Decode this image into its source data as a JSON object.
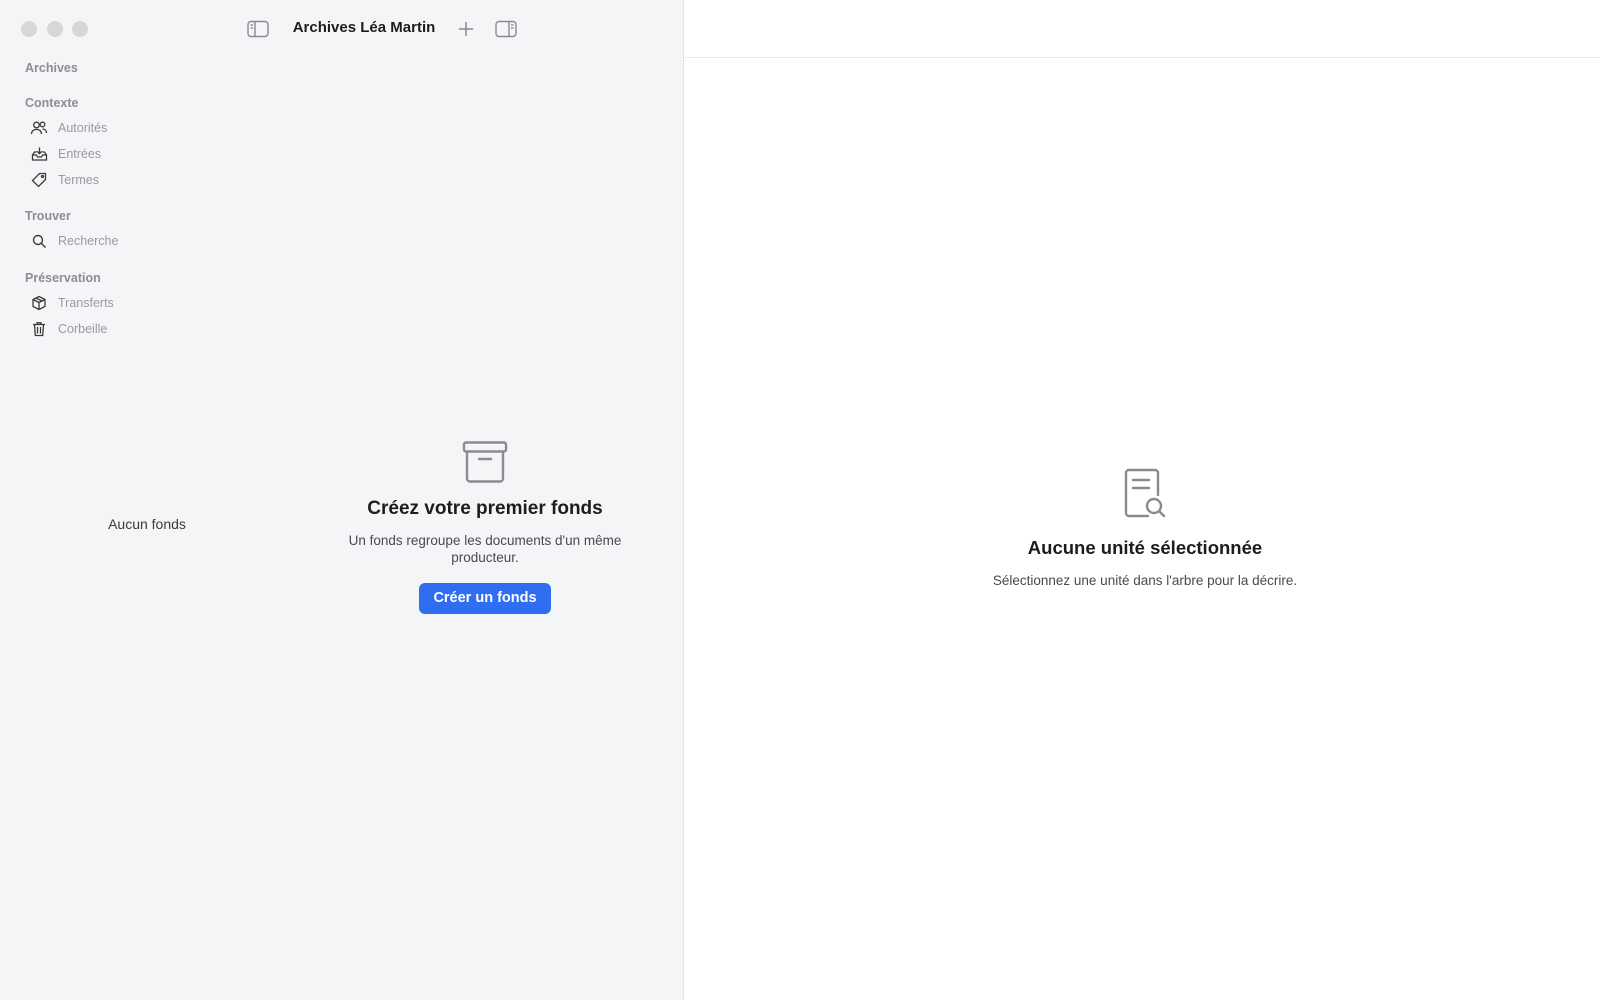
{
  "window": {
    "title": "Archives Léa Martin"
  },
  "sidebar": {
    "root_label": "Archives",
    "sections": [
      {
        "title": "Contexte",
        "items": [
          {
            "label": "Autorités",
            "icon": "users-icon"
          },
          {
            "label": "Entrées",
            "icon": "inbox-tray-icon"
          },
          {
            "label": "Termes",
            "icon": "tag-icon"
          }
        ]
      },
      {
        "title": "Trouver",
        "items": [
          {
            "label": "Recherche",
            "icon": "search-icon"
          }
        ]
      },
      {
        "title": "Préservation",
        "items": [
          {
            "label": "Transferts",
            "icon": "package-icon"
          },
          {
            "label": "Corbeille",
            "icon": "trash-icon"
          }
        ]
      }
    ]
  },
  "fonds_list": {
    "empty_label": "Aucun fonds"
  },
  "create_panel": {
    "icon": "archive-box-icon",
    "title": "Créez votre premier fonds",
    "description": "Un fonds regroupe les documents d'un même producteur.",
    "button_label": "Créer un fonds",
    "button_color": "#2f6ef2"
  },
  "detail": {
    "icon": "document-search-icon",
    "title": "Aucune unité sélectionnée",
    "description": "Sélectionnez une unité dans l'arbre pour la décrire."
  }
}
